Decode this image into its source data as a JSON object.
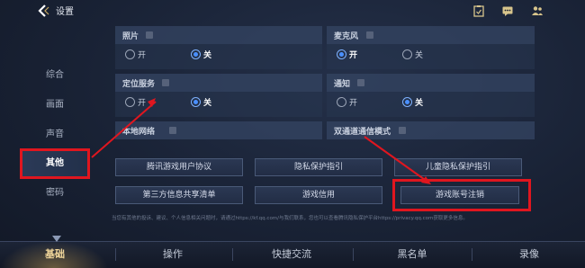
{
  "header": {
    "title": "设置"
  },
  "nav": {
    "items": [
      {
        "label": "综合"
      },
      {
        "label": "画面"
      },
      {
        "label": "声音"
      },
      {
        "label": "其他"
      },
      {
        "label": "密码"
      }
    ],
    "active": "其他"
  },
  "settings": {
    "photo": {
      "title": "照片",
      "on": "开",
      "off": "关",
      "selected": "关"
    },
    "mic": {
      "title": "麦克风",
      "on": "开",
      "off": "关",
      "selected": "开"
    },
    "location": {
      "title": "定位服务",
      "on": "开",
      "off": "关",
      "selected": "关"
    },
    "notify": {
      "title": "通知",
      "on": "开",
      "off": "关",
      "selected": "关"
    },
    "local_network": {
      "title": "本地网络"
    },
    "dual_channel": {
      "title": "双通道通信模式"
    }
  },
  "links": {
    "user_agreement": "腾讯游戏用户协议",
    "privacy": "隐私保护指引",
    "child_privacy": "儿童隐私保护指引",
    "third_party": "第三方信息共享清单",
    "credit": "游戏信用",
    "delete_account": "游戏账号注销"
  },
  "footnote": "当您有其他的投诉、建议、个人信息相关问题时，请通过https://kf.qq.com/与我们联系，您也可以查看腾讯隐私保护平台https://privacy.qq.com获取更多信息。",
  "bottom_tabs": [
    {
      "label": "基础"
    },
    {
      "label": "操作"
    },
    {
      "label": "快捷交流"
    },
    {
      "label": "黑名单"
    },
    {
      "label": "录像"
    }
  ],
  "colors": {
    "accent_blue": "#4a90ff",
    "highlight_red": "#e0161f",
    "active_tab_gold": "#f1d79b"
  }
}
